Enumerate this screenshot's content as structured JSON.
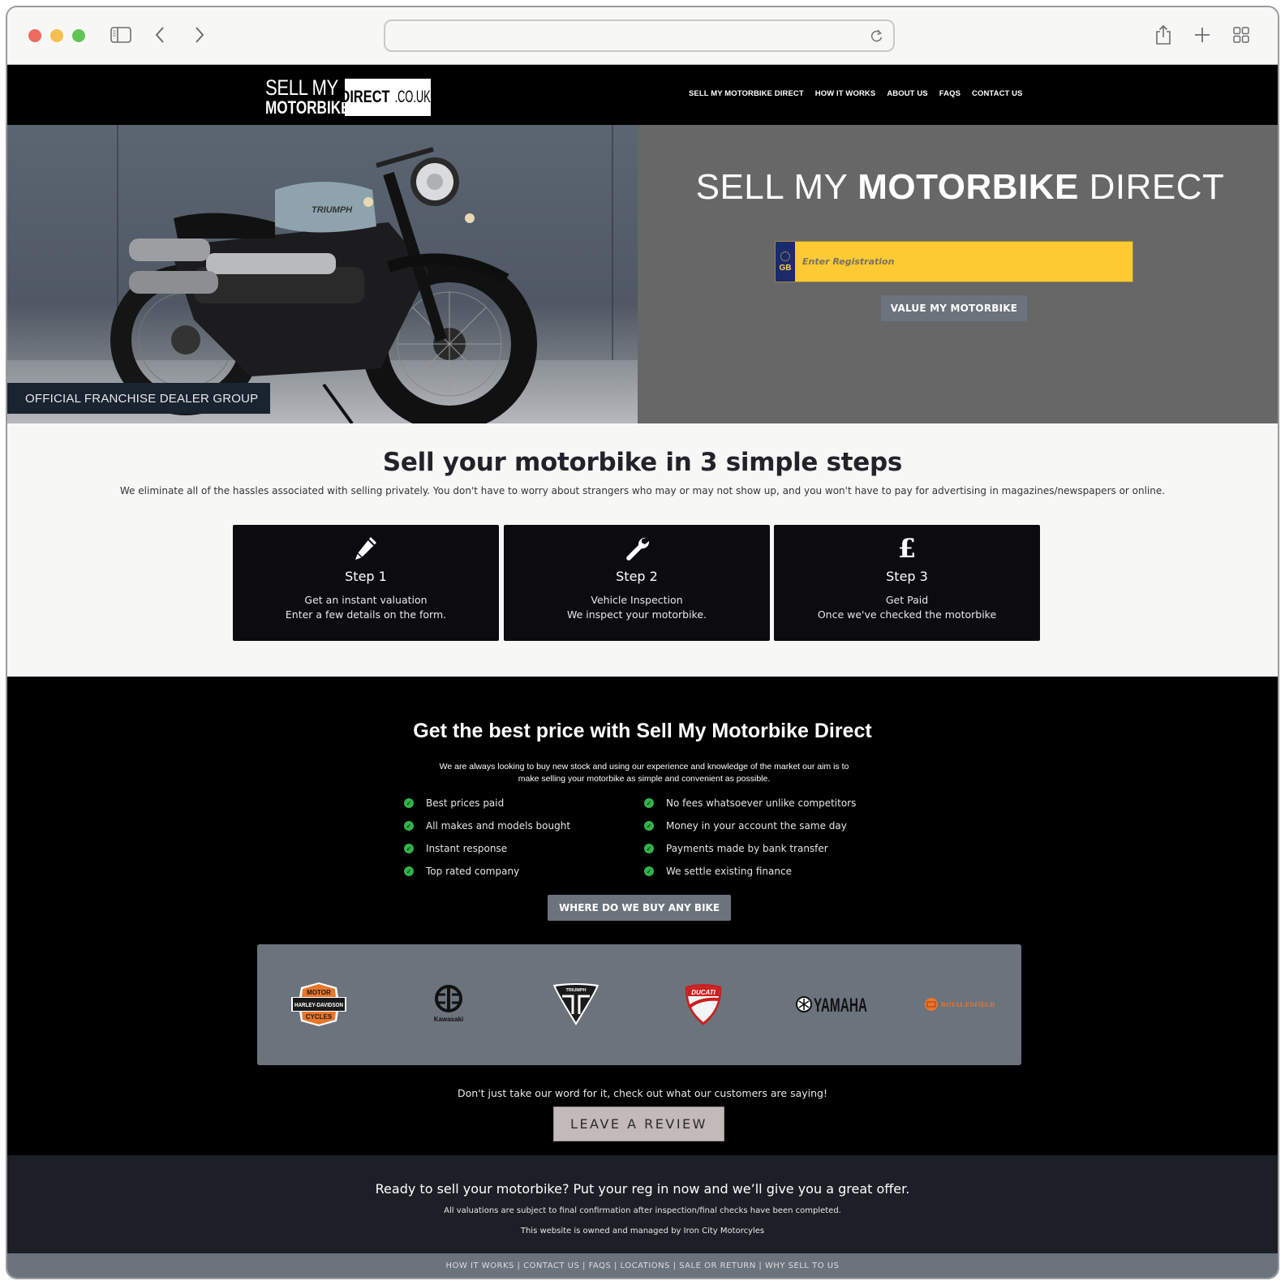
{
  "browser": {
    "address_value": "",
    "icons": [
      "sidebar-icon",
      "chevron-left-icon",
      "chevron-right-icon",
      "reload-icon",
      "share-icon",
      "plus-icon",
      "tab-grid-icon"
    ]
  },
  "header": {
    "logo": {
      "line1": "SELL MY",
      "line2": "MOTORBIKE",
      "box_bold": "DIRECT",
      "box_rest": ".CO.UK"
    },
    "nav": [
      "SELL MY MOTORBIKE DIRECT",
      "HOW IT WORKS",
      "ABOUT US",
      "FAQS",
      "CONTACT US"
    ]
  },
  "hero": {
    "badge": "OFFICIAL FRANCHISE DEALER GROUP",
    "title_pre": "SELL MY ",
    "title_bold": "MOTORBIKE",
    "title_post": " DIRECT",
    "plate_country": "GB",
    "reg_placeholder": "Enter Registration",
    "reg_value": "",
    "value_button": "VALUE MY MOTORBIKE",
    "plate_color": "#fdca33"
  },
  "steps": {
    "title": "Sell your motorbike in 3 simple steps",
    "subtitle": "We eliminate all of the hassles associated with selling privately. You don't have to worry about strangers who may or may not show up, and you won't have to pay for advertising in magazines/newspapers or online.",
    "items": [
      {
        "icon": "pencil-icon",
        "name": "Step 1",
        "line1": "Get an instant valuation",
        "line2": "Enter a few details on the form."
      },
      {
        "icon": "wrench-icon",
        "name": "Step 2",
        "line1": "Vehicle Inspection",
        "line2": "We inspect your motorbike."
      },
      {
        "icon": "pound-icon",
        "glyph": "£",
        "name": "Step 3",
        "line1": "Get Paid",
        "line2": "Once we've checked the motorbike"
      }
    ]
  },
  "best_price": {
    "title": "Get the best price with Sell My Motorbike Direct",
    "subtitle": "We are always looking to buy new stock and using our experience and knowledge of the market our aim is to make selling your motorbike as simple and convenient as possible.",
    "features_left": [
      "Best prices paid",
      "All makes and models bought",
      "Instant response",
      "Top rated company"
    ],
    "features_right": [
      "No fees whatsoever unlike competitors",
      "Money in your account the same day",
      "Payments made by bank transfer",
      "We settle existing finance"
    ],
    "where_button": "WHERE DO WE BUY ANY BIKE",
    "check_color": "#33b24a",
    "brands": [
      {
        "name": "Harley-Davidson",
        "top": "MOTOR",
        "mid": "HARLEY-DAVIDSON",
        "bottom": "CYCLES"
      },
      {
        "name": "Kawasaki",
        "label": "Kawasaki"
      },
      {
        "name": "Triumph",
        "label": "TRIUMPH"
      },
      {
        "name": "Ducati",
        "label": "DUCATI"
      },
      {
        "name": "Yamaha",
        "label": "YAMAHA"
      },
      {
        "name": "Royal Enfield",
        "label": "ROYAL ENFIELD"
      }
    ],
    "review_text": "Don't just take our word for it, check out what our customers are saying!",
    "review_button": "LEAVE A REVIEW"
  },
  "footer": {
    "cta": "Ready to sell your motorbike? Put your reg in now and we’ll give you a great offer.",
    "note": "All valuations are subject to final confirmation after inspection/final checks have been completed.",
    "owner": "This website is owned and managed by Iron City Motorcyles",
    "links": "HOW IT WORKS | CONTACT US | FAQS | LOCATIONS | SALE OR RETURN | WHY SELL TO US"
  }
}
